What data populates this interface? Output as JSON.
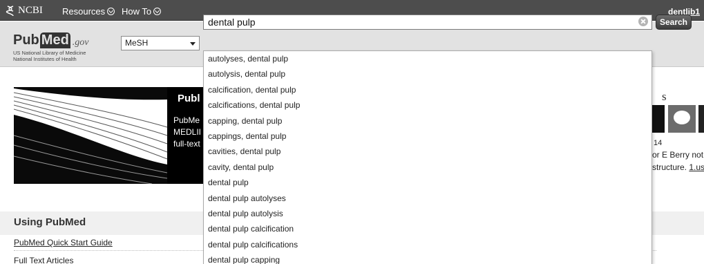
{
  "topbar": {
    "logo_text": "NCBI",
    "resources_label": "Resources",
    "howto_label": "How To",
    "user_label": "dentlib1"
  },
  "header": {
    "logo_pub": "Pub",
    "logo_med": "Med",
    "logo_gov": ".gov",
    "nlm_line1": "US National Library of Medicine",
    "nlm_line2": "National Institutes of Health",
    "database_selected": "MeSH",
    "search_value": "dental pulp",
    "search_button_label": "Search"
  },
  "autocomplete": {
    "items": [
      "autolyses, dental pulp",
      "autolysis, dental pulp",
      "calcification, dental pulp",
      "calcifications, dental pulp",
      "capping, dental pulp",
      "cappings, dental pulp",
      "cavities, dental pulp",
      "cavity, dental pulp",
      "dental pulp",
      "dental pulp autolyses",
      "dental pulp autolysis",
      "dental pulp calcification",
      "dental pulp calcifications",
      "dental pulp capping"
    ]
  },
  "banner": {
    "title": "Publ",
    "line1": "PubMe",
    "line2": "MEDLII",
    "line3": "full-text"
  },
  "right_panel": {
    "title_fragment": "s",
    "date_fragment": "14",
    "line1": "or E Berry not",
    "line2_text": "structure.",
    "line2_link": "1.us"
  },
  "using": {
    "title": "Using PubMed",
    "quick_start": "PubMed Quick Start Guide",
    "full_text": "Full Text Articles"
  },
  "colors": {
    "topbar_bg": "#4d4d4d",
    "header_bg": "#e2e2e2",
    "search_button_bg": "#3c3c3c"
  }
}
